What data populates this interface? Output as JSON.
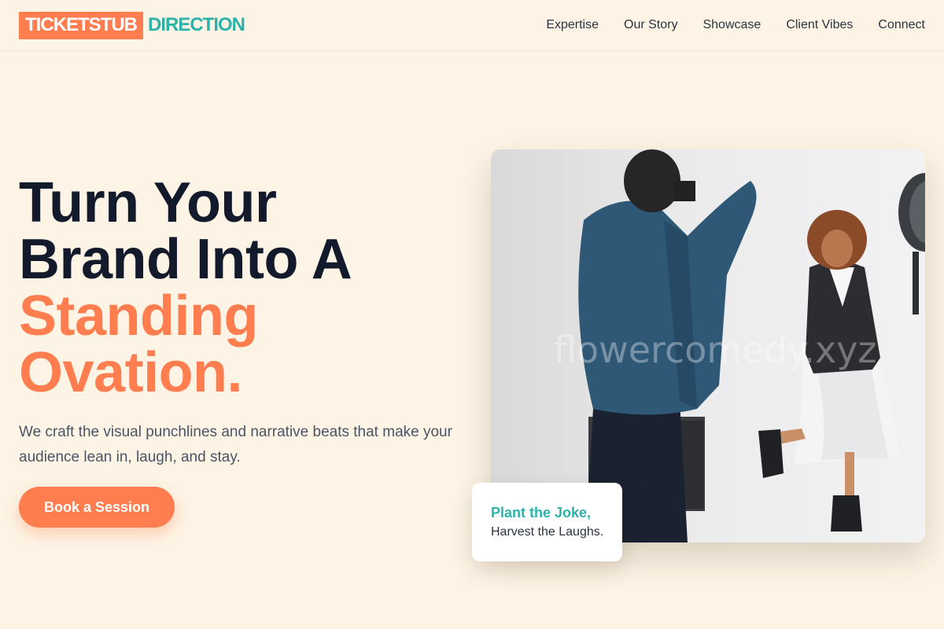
{
  "header": {
    "logo_box": "TICKETSTUB",
    "logo_rest": "DIRECTION",
    "nav": [
      "Expertise",
      "Our Story",
      "Showcase",
      "Client Vibes",
      "Connect"
    ]
  },
  "hero": {
    "headline_line1": "Turn Your",
    "headline_line2": "Brand Into A",
    "headline_line3": "Standing",
    "headline_line4": "Ovation.",
    "subtext": "We craft the visual punchlines and narrative beats that make your audience lean in, laugh, and stay.",
    "cta_label": "Book a Session"
  },
  "photo": {
    "watermark": "flowercomedy.xyz"
  },
  "card": {
    "title": "Plant the Joke,",
    "subtitle": "Harvest the Laughs."
  },
  "colors": {
    "background": "#fdf4e5",
    "accent": "#ff7d4e",
    "teal": "#2bb3aa",
    "heading": "#131a2b"
  }
}
